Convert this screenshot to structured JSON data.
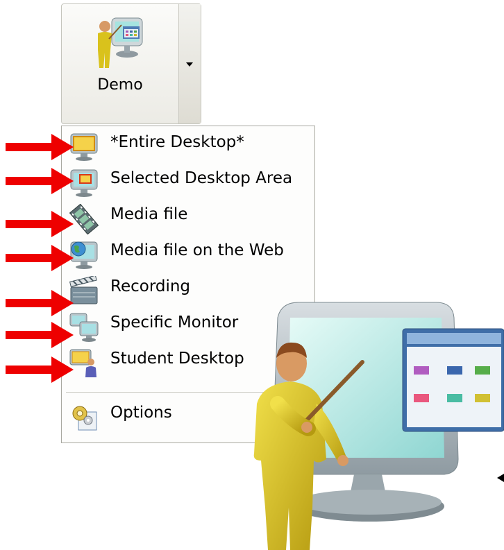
{
  "demo_button": {
    "label": "Demo"
  },
  "menu": {
    "items": [
      {
        "label": "*Entire Desktop*",
        "icon": "desktop-monitor-icon"
      },
      {
        "label": "Selected Desktop Area",
        "icon": "selected-area-icon"
      },
      {
        "label": "Media file",
        "icon": "film-strip-icon"
      },
      {
        "label": "Media file on the Web",
        "icon": "web-globe-monitor-icon"
      },
      {
        "label": "Recording",
        "icon": "clapperboard-icon"
      },
      {
        "label": "Specific Monitor",
        "icon": "dual-monitor-icon"
      },
      {
        "label": "Student Desktop",
        "icon": "student-desktop-icon"
      }
    ],
    "options": {
      "label": "Options",
      "icon": "gears-icon"
    }
  },
  "colors": {
    "arrow": "#ee0000",
    "teacher": "#d9c21c",
    "monitor": "#bfe8e4"
  }
}
